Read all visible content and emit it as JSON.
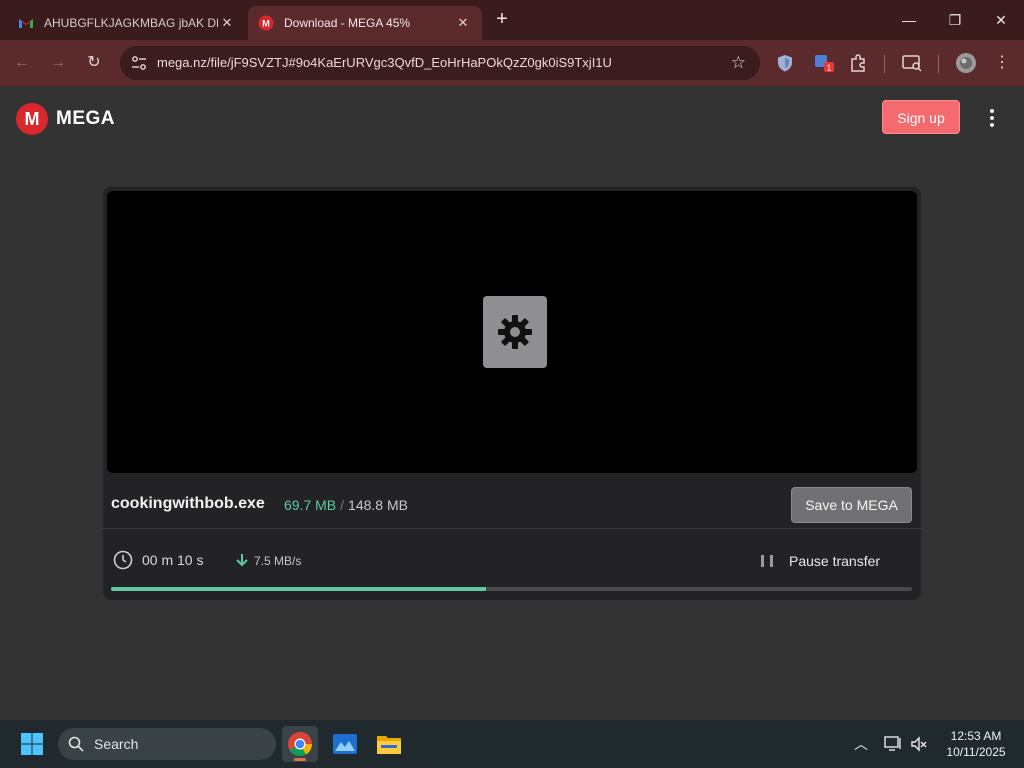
{
  "browser": {
    "tabs": [
      {
        "title": "AHUBGFLKJAGKMBAG jbAK DN",
        "icon": "gmail-icon",
        "active": false
      },
      {
        "title": "Download - MEGA 45%",
        "icon": "mega-icon",
        "active": true
      }
    ],
    "url": "mega.nz/file/jF9SVZTJ#9o4KaErURVgc3QvfD_EoHrHaPOkQzZ0gk0iS9TxjI1U",
    "extension_badge": "1"
  },
  "mega": {
    "logo_letter": "M",
    "logo_text": "MEGA",
    "signup_label": "Sign up",
    "file": {
      "name": "cookingwithbob.exe",
      "downloaded": "69.7 MB",
      "separator": "/",
      "total": "148.8 MB"
    },
    "save_label": "Save to MEGA",
    "time_remaining": "00 m  10 s",
    "speed": "7.5 MB/s",
    "pause_label": "Pause transfer",
    "progress_percent": 46.8,
    "colors": {
      "accent": "#5fc9a3",
      "brand": "#d9272e",
      "signup": "#f46a6e"
    }
  },
  "taskbar": {
    "search_label": "Search",
    "time": "12:53 AM",
    "date": "10/11/2025"
  }
}
